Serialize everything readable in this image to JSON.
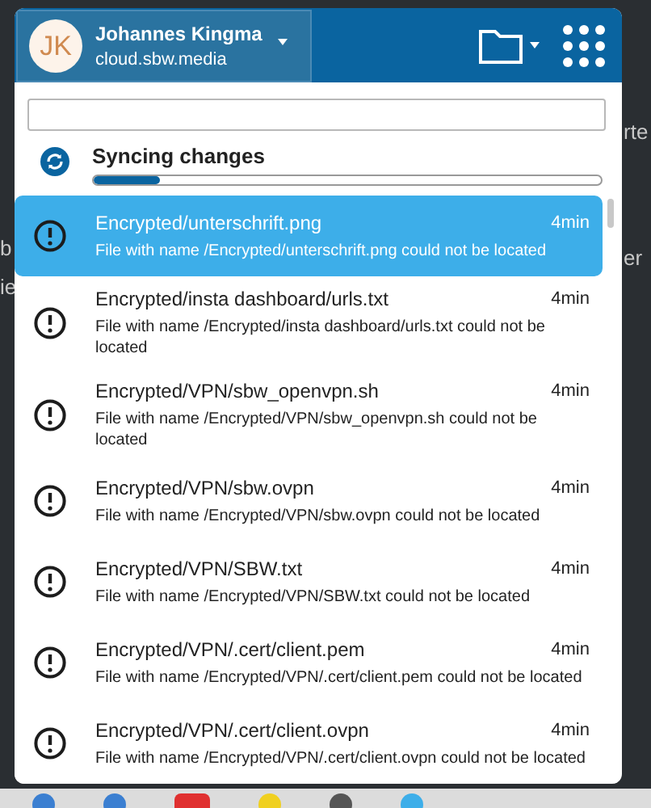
{
  "background_texts": [
    {
      "text": "rte",
      "kind": "right2"
    },
    {
      "text": "b",
      "kind": "left3"
    },
    {
      "text": "er",
      "kind": "right3"
    },
    {
      "text": "ie",
      "kind": "left4"
    }
  ],
  "account": {
    "initials": "JK",
    "name": "Johannes Kingma",
    "server": "cloud.sbw.media"
  },
  "sync": {
    "label": "Syncing changes",
    "level": 0.13
  },
  "activities": [
    {
      "title": "Encrypted/unterschrift.png",
      "time": "4min",
      "message": "File with name /Encrypted/unterschrift.png could not be located",
      "selected": true
    },
    {
      "title": "Encrypted/insta dashboard/urls.txt",
      "time": "4min",
      "message": "File with name /Encrypted/insta dashboard/urls.txt could not be located",
      "selected": false
    },
    {
      "title": "Encrypted/VPN/sbw_openvpn.sh",
      "time": "4min",
      "message": "File with name /Encrypted/VPN/sbw_openvpn.sh could not be located",
      "selected": false
    },
    {
      "title": "Encrypted/VPN/sbw.ovpn",
      "time": "4min",
      "message": "File with name /Encrypted/VPN/sbw.ovpn could not be located",
      "selected": false
    },
    {
      "title": "Encrypted/VPN/SBW.txt",
      "time": "4min",
      "message": "File with name /Encrypted/VPN/SBW.txt could not be located",
      "selected": false
    },
    {
      "title": "Encrypted/VPN/.cert/client.pem",
      "time": "4min",
      "message": "File with name /Encrypted/VPN/.cert/client.pem could not be located",
      "selected": false
    },
    {
      "title": "Encrypted/VPN/.cert/client.ovpn",
      "time": "4min",
      "message": "File with name /Encrypted/VPN/.cert/client.ovpn could not be located",
      "selected": false
    }
  ]
}
